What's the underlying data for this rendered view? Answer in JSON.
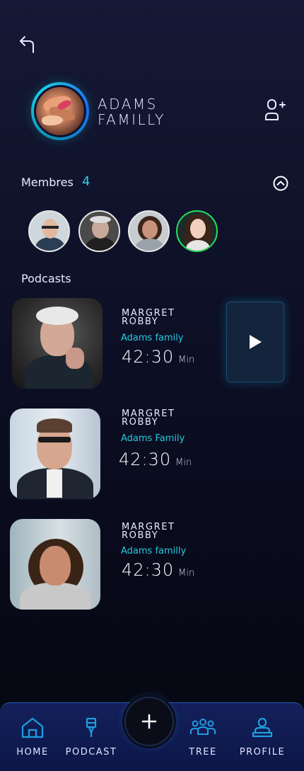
{
  "header": {
    "back_icon": "back-arrow-icon",
    "family_name_line1": "ADAMS",
    "family_name_line2": "FAMILLY",
    "add_member_icon": "add-user-icon"
  },
  "members": {
    "label": "Membres",
    "count": "4",
    "collapse_icon": "chevron-up-circle-icon",
    "avatars": [
      "member-1",
      "member-2",
      "member-3",
      "member-4"
    ]
  },
  "podcasts": {
    "label": "Podcasts",
    "items": [
      {
        "name_line1": "MARGRET",
        "name_line2": "ROBBY",
        "family": "Adams family",
        "duration": "42:30",
        "unit": "Min"
      },
      {
        "name_line1": "MARGRET",
        "name_line2": "ROBBY",
        "family": "Adams Family",
        "duration": "42:30",
        "unit": "Min"
      },
      {
        "name_line1": "MARGRET",
        "name_line2": "ROBBY",
        "family": "Adams familly",
        "duration": "42:30",
        "unit": "Min"
      }
    ]
  },
  "nav": {
    "home": "HOME",
    "podcast": "PODCAST",
    "tree": "TREE",
    "profile": "PROFILE",
    "add_icon": "plus-icon"
  },
  "colors": {
    "accent": "#28d3e6",
    "active_member_ring": "#27e05a",
    "nav_background": "#14205a"
  }
}
